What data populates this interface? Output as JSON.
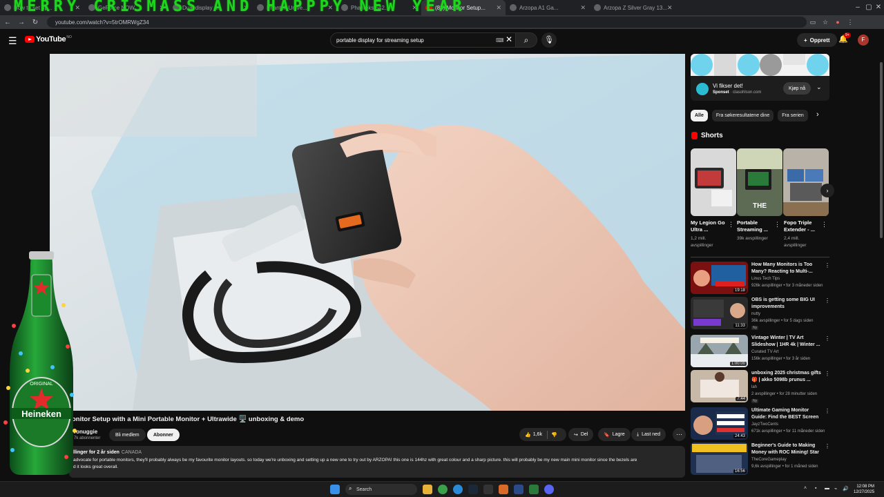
{
  "browser": {
    "banner_text": "MERRY CRISMASS AND HAPPPY NEW YEAR",
    "tabs": [
      {
        "title": "How to set up..."
      },
      {
        "title": "GeForce NOW..."
      },
      {
        "title": "Dual display a..."
      },
      {
        "title": "Phantek Unive..."
      },
      {
        "title": "Phanteks 542..."
      },
      {
        "title": "(88) Monitor Setup...",
        "active": true
      },
      {
        "title": "Arzopa A1 Ga..."
      },
      {
        "title": "Arzopa Z Silver Gray 13..."
      }
    ],
    "url": "youtube.com/watch?v=5trOMRWgZ34"
  },
  "header": {
    "logo_text": "YouTube",
    "logo_region": "NO",
    "search_value": "portable display for streaming setup",
    "create_label": "Opprett",
    "notification_count": "9+",
    "avatar_initial": "F"
  },
  "video": {
    "title": "onitor Setup with a Mini Portable Monitor + Ultrawide 🖥️ unboxing & demo",
    "channel": "ronuggie",
    "subscribers": "7k abonnenter",
    "join_label": "Bli medlem",
    "subscribe_label": "Abonner",
    "likes": "1,6k",
    "share_label": "Del",
    "save_label": "Lagre",
    "download_label": "Last ned",
    "desc_meta": "llinger  for 2 år siden",
    "desc_location": "CANADA",
    "desc_text": "advocate for portable monitors, they'll probably always be my favourite monitor layouts. so today we're unboxing and setting up a new one to try out by ARZOPA! this one is 144hz with great colour and a sharp picture. this will probably be my new main mini monitor since the bezels are\nd it looks great overall."
  },
  "ad": {
    "title": "Vi fikser det!",
    "sponsor_label": "Sponset",
    "domain": "clasohlson.com",
    "buy_label": "Kjøp nå"
  },
  "chips": [
    "Alle",
    "Fra søkeresultatene dine",
    "Fra serien"
  ],
  "shorts": {
    "heading": "Shorts",
    "items": [
      {
        "title": "My Legion Go Ultra ...",
        "views": "1,2 mill. avspillinger"
      },
      {
        "title": "Portable Streaming ...",
        "views": "39k avspillinger",
        "overlay": "THE"
      },
      {
        "title": "Fopo Triple Extender - ...",
        "views": "2,4 mill. avspillinger"
      }
    ]
  },
  "recommendations": [
    {
      "title": "How Many Monitors is Too Many? Reacting to Multi-...",
      "channel": "Linus Tech Tips",
      "meta": "926k avspillinger • for 3 måneder siden",
      "duration": "19:18",
      "thumb_text": "8 MONITORS"
    },
    {
      "title": "OBS is getting some BIG UI improvements",
      "channel": "nutty",
      "meta": "36k avspillinger • for 5 dags siden",
      "duration": "11:33",
      "badge": "Ny",
      "thumb_text": "BIG OBS UI UPDATES"
    },
    {
      "title": "Vintage Winter | TV Art Slideshow | 1HR 4k | Winter ...",
      "channel": "Curated TV Art",
      "meta": "156k avspillinger • for 3 år siden",
      "duration": "1:00:00",
      "thumb_text": "VINTAGE WINTER"
    },
    {
      "title": "unboxing 2025 christmas gifts 🎁 | akko 5098b prunus ...",
      "channel": "lah",
      "meta": "2 avspillinger • for 28 minutter siden",
      "duration": "7:44",
      "badge": "Ny"
    },
    {
      "title": "Ultimate Gaming Monitor Guide: Find the BEST Screen for Your ...",
      "channel": "JayzTwoCents",
      "meta": "671k avspillinger • for 11 måneder siden",
      "duration": "24:43",
      "thumb_text": "GAMING MONITORS EXPLAINED"
    },
    {
      "title": "Beginner's Guide to Making Money with ROC Mining! Star ...",
      "channel": "TheCoreGameplay",
      "meta": "9,6k avspillinger • for 1 måned siden",
      "duration": "16:56",
      "thumb_text": "EASY MONEY GUIDE"
    }
  ],
  "taskbar": {
    "search_placeholder": "Search",
    "time": "12:08 PM",
    "date": "12/27/2025"
  },
  "decoration": {
    "beer_brand": "Heineken",
    "beer_text": "ORIGINAL"
  },
  "colors": {
    "youtube_red": "#ff0000",
    "banner_green": "#1fd61f",
    "page_bg": "#0f0f0f"
  }
}
